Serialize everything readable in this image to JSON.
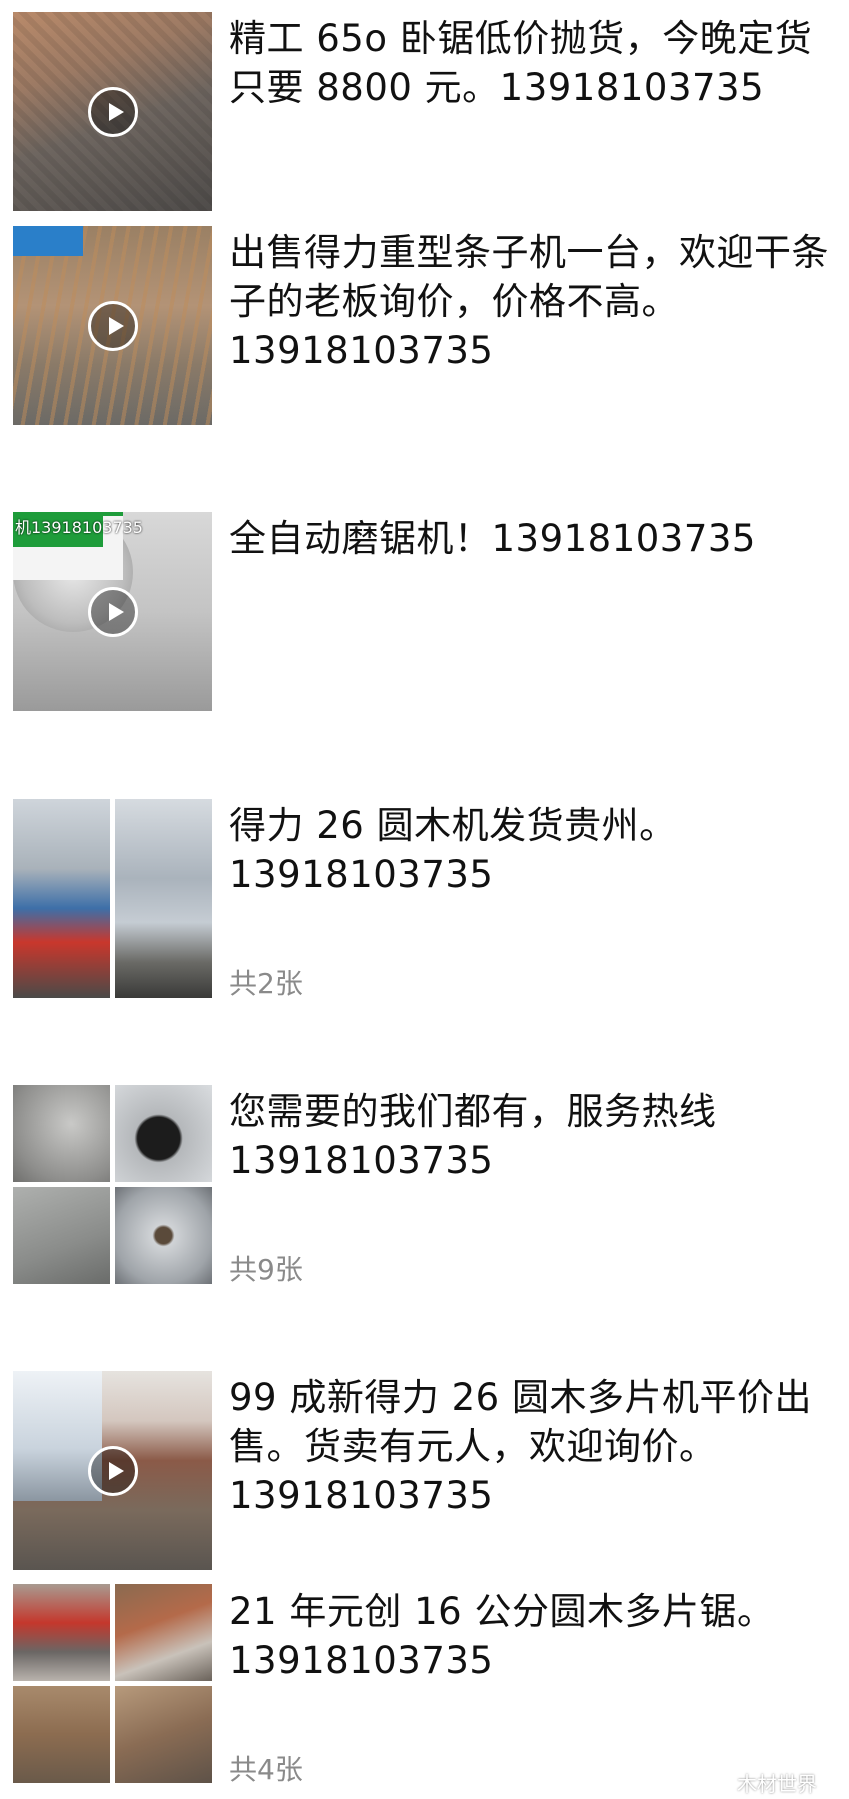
{
  "posts": [
    {
      "text": "精工 65o 卧锯低价抛货，今晚定货只要 8800 元。13918103735",
      "media": "video"
    },
    {
      "text": "出售得力重型条子机一台，欢迎干条子的老板询价，价格不高。13918103735",
      "media": "video"
    },
    {
      "text": "全自动磨锯机！13918103735",
      "media": "video",
      "overlay": "机13918103735"
    },
    {
      "text": "得力 26 圆木机发货贵州。13918103735",
      "media": "images",
      "count": "共2张"
    },
    {
      "text": "您需要的我们都有，服务热线 13918103735",
      "media": "images",
      "count": "共9张"
    },
    {
      "text": "99 成新得力 26 圆木多片机平价出售。货卖有元人，欢迎询价。13918103735",
      "media": "video"
    },
    {
      "text": "21 年元创 16 公分圆木多片锯。13918103735",
      "media": "images",
      "count": "共4张"
    }
  ],
  "watermark": {
    "text": "木材世界",
    "icon": "wechat-icon"
  },
  "colors": {
    "text": "#111111",
    "muted": "#8a8a8a",
    "background": "#ffffff"
  }
}
